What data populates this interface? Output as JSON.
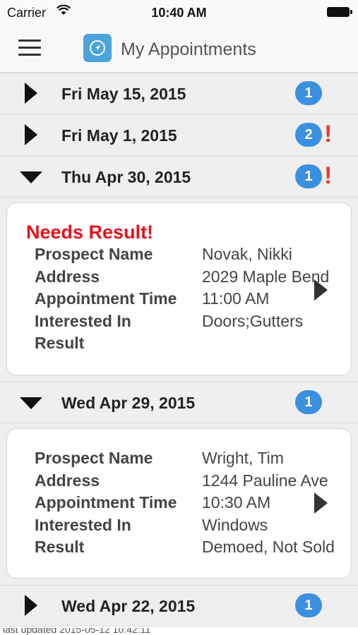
{
  "status_bar": {
    "carrier": "Carrier",
    "time": "10:40 AM"
  },
  "nav": {
    "title": "My Appointments"
  },
  "labels": {
    "prospect_name": "Prospect Name",
    "address": "Address",
    "appointment_time": "Appointment Time",
    "interested_in": "Interested In",
    "result": "Result"
  },
  "groups": [
    {
      "date": "Fri May 15, 2015",
      "count": "1",
      "alert": "",
      "expanded": false
    },
    {
      "date": "Fri May 1, 2015",
      "count": "2",
      "alert": "!",
      "expanded": false
    },
    {
      "date": "Thu Apr 30, 2015",
      "count": "1",
      "alert": "!",
      "expanded": true
    },
    {
      "date": "Wed Apr 29, 2015",
      "count": "1",
      "alert": "",
      "expanded": true
    },
    {
      "date": "Wed Apr 22, 2015",
      "count": "1",
      "alert": "",
      "expanded": false
    }
  ],
  "appointments": [
    {
      "flag": "Needs Result!",
      "prospect_name": "Novak, Nikki",
      "address": "2029 Maple Bend",
      "appointment_time": "11:00 AM",
      "interested_in": "Doors;Gutters",
      "result": ""
    },
    {
      "flag": "",
      "prospect_name": "Wright, Tim",
      "address": "1244 Pauline Ave",
      "appointment_time": "10:30 AM",
      "interested_in": "Windows",
      "result": "Demoed, Not Sold"
    }
  ],
  "footer": {
    "text": "last updated 2015-05-12 10:42:11"
  },
  "colors": {
    "badge": "#3a8fe0",
    "alert": "#e63b2e",
    "needs_result": "#e8101b",
    "app_icon": "#4aa3d9"
  }
}
